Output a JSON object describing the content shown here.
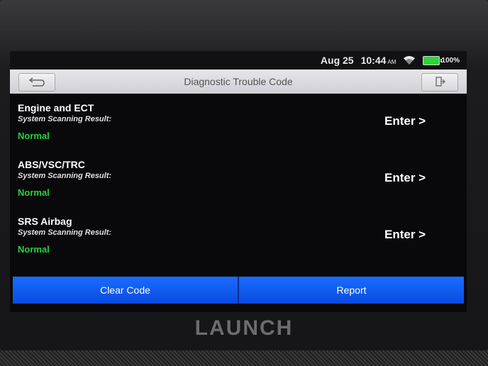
{
  "status_bar": {
    "date": "Aug 25",
    "time": "10:44",
    "ampm": "AM",
    "battery": "100%",
    "battery_color": "#2fd33a"
  },
  "title_bar": {
    "title": "Diagnostic Trouble Code",
    "back_icon": "back-arrow-icon",
    "exit_icon": "exit-icon"
  },
  "systems": [
    {
      "name": "Engine and ECT",
      "subtitle": "System Scanning Result:",
      "status": "Normal",
      "action": "Enter >"
    },
    {
      "name": "ABS/VSC/TRC",
      "subtitle": "System Scanning Result:",
      "status": "Normal",
      "action": "Enter >"
    },
    {
      "name": "SRS Airbag",
      "subtitle": "System Scanning Result:",
      "status": "Normal",
      "action": "Enter >"
    }
  ],
  "actions": {
    "clear_code": "Clear Code",
    "report": "Report",
    "accent": "#1a6cff"
  },
  "device": {
    "brand": "LAUNCH"
  }
}
